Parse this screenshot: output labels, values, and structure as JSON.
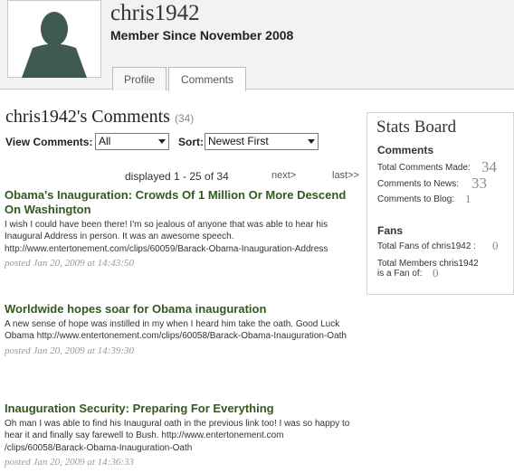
{
  "profile": {
    "username": "chris1942",
    "member_since": "Member Since November 2008",
    "tabs": [
      "Profile",
      "Comments"
    ],
    "active_tab": "Comments"
  },
  "comments_section": {
    "title": "chris1942's Comments",
    "count": "(34)",
    "view_label": "View Comments:",
    "view_value": "All",
    "sort_label": "Sort:",
    "sort_value": "Newest First",
    "pager": {
      "info": "displayed 1 - 25 of 34",
      "next": "next>",
      "last": "last>>"
    },
    "comments": [
      {
        "title": "Obama's Inauguration: Crowds Of 1 Million Or More Descend On Washington",
        "body": "I wish I could have been there! I'm so jealous of anyone that was able to hear his Inaugural Address in person. It was an awesome speech. http://www.entertonement.com/clips/60059/Barack-Obama-Inauguration-Address",
        "date": "posted Jan 20, 2009 at 14:43:50"
      },
      {
        "title": "Worldwide hopes soar for Obama inauguration",
        "body": "A new sense of hope was instilled in my when I heard him take the oath. Good Luck Obama http://www.entertonement.com/clips/60058/Barack-Obama-Inauguration-Oath",
        "date": "posted Jan 20, 2009 at 14:39:30"
      },
      {
        "title": "Inauguration Security: Preparing For Everything",
        "body": "Oh man I was able to find his Inaugural oath in the previous link too! I was so happy to hear it and finally say farewell to Bush. http://www.entertonement.com /clips/60058/Barack-Obama-Inauguration-Oath",
        "date": "posted Jan 20, 2009 at 14:36:33"
      }
    ]
  },
  "stats_board": {
    "title": "Stats Board",
    "comments_heading": "Comments",
    "total_comments_label": "Total Comments Made:",
    "total_comments_value": "34",
    "comments_news_label": "Comments to News:",
    "comments_news_value": "33",
    "comments_blog_label": "Comments to Blog:",
    "comments_blog_value": "1",
    "fans_heading": "Fans",
    "total_fans_label": "Total Fans of chris1942 :",
    "total_fans_value": "0",
    "member_is_fan_label_1": "Total Members chris1942",
    "member_is_fan_label_2": "is a Fan of:",
    "member_is_fan_value": "0"
  },
  "colors": {
    "link_green": "#335a1e",
    "muted_number": "#8a8a8a",
    "header_band": "#f2f2f2"
  },
  "icons": {
    "avatar": "default-user-silhouette-icon",
    "select_caret": "chevron-down-icon"
  }
}
